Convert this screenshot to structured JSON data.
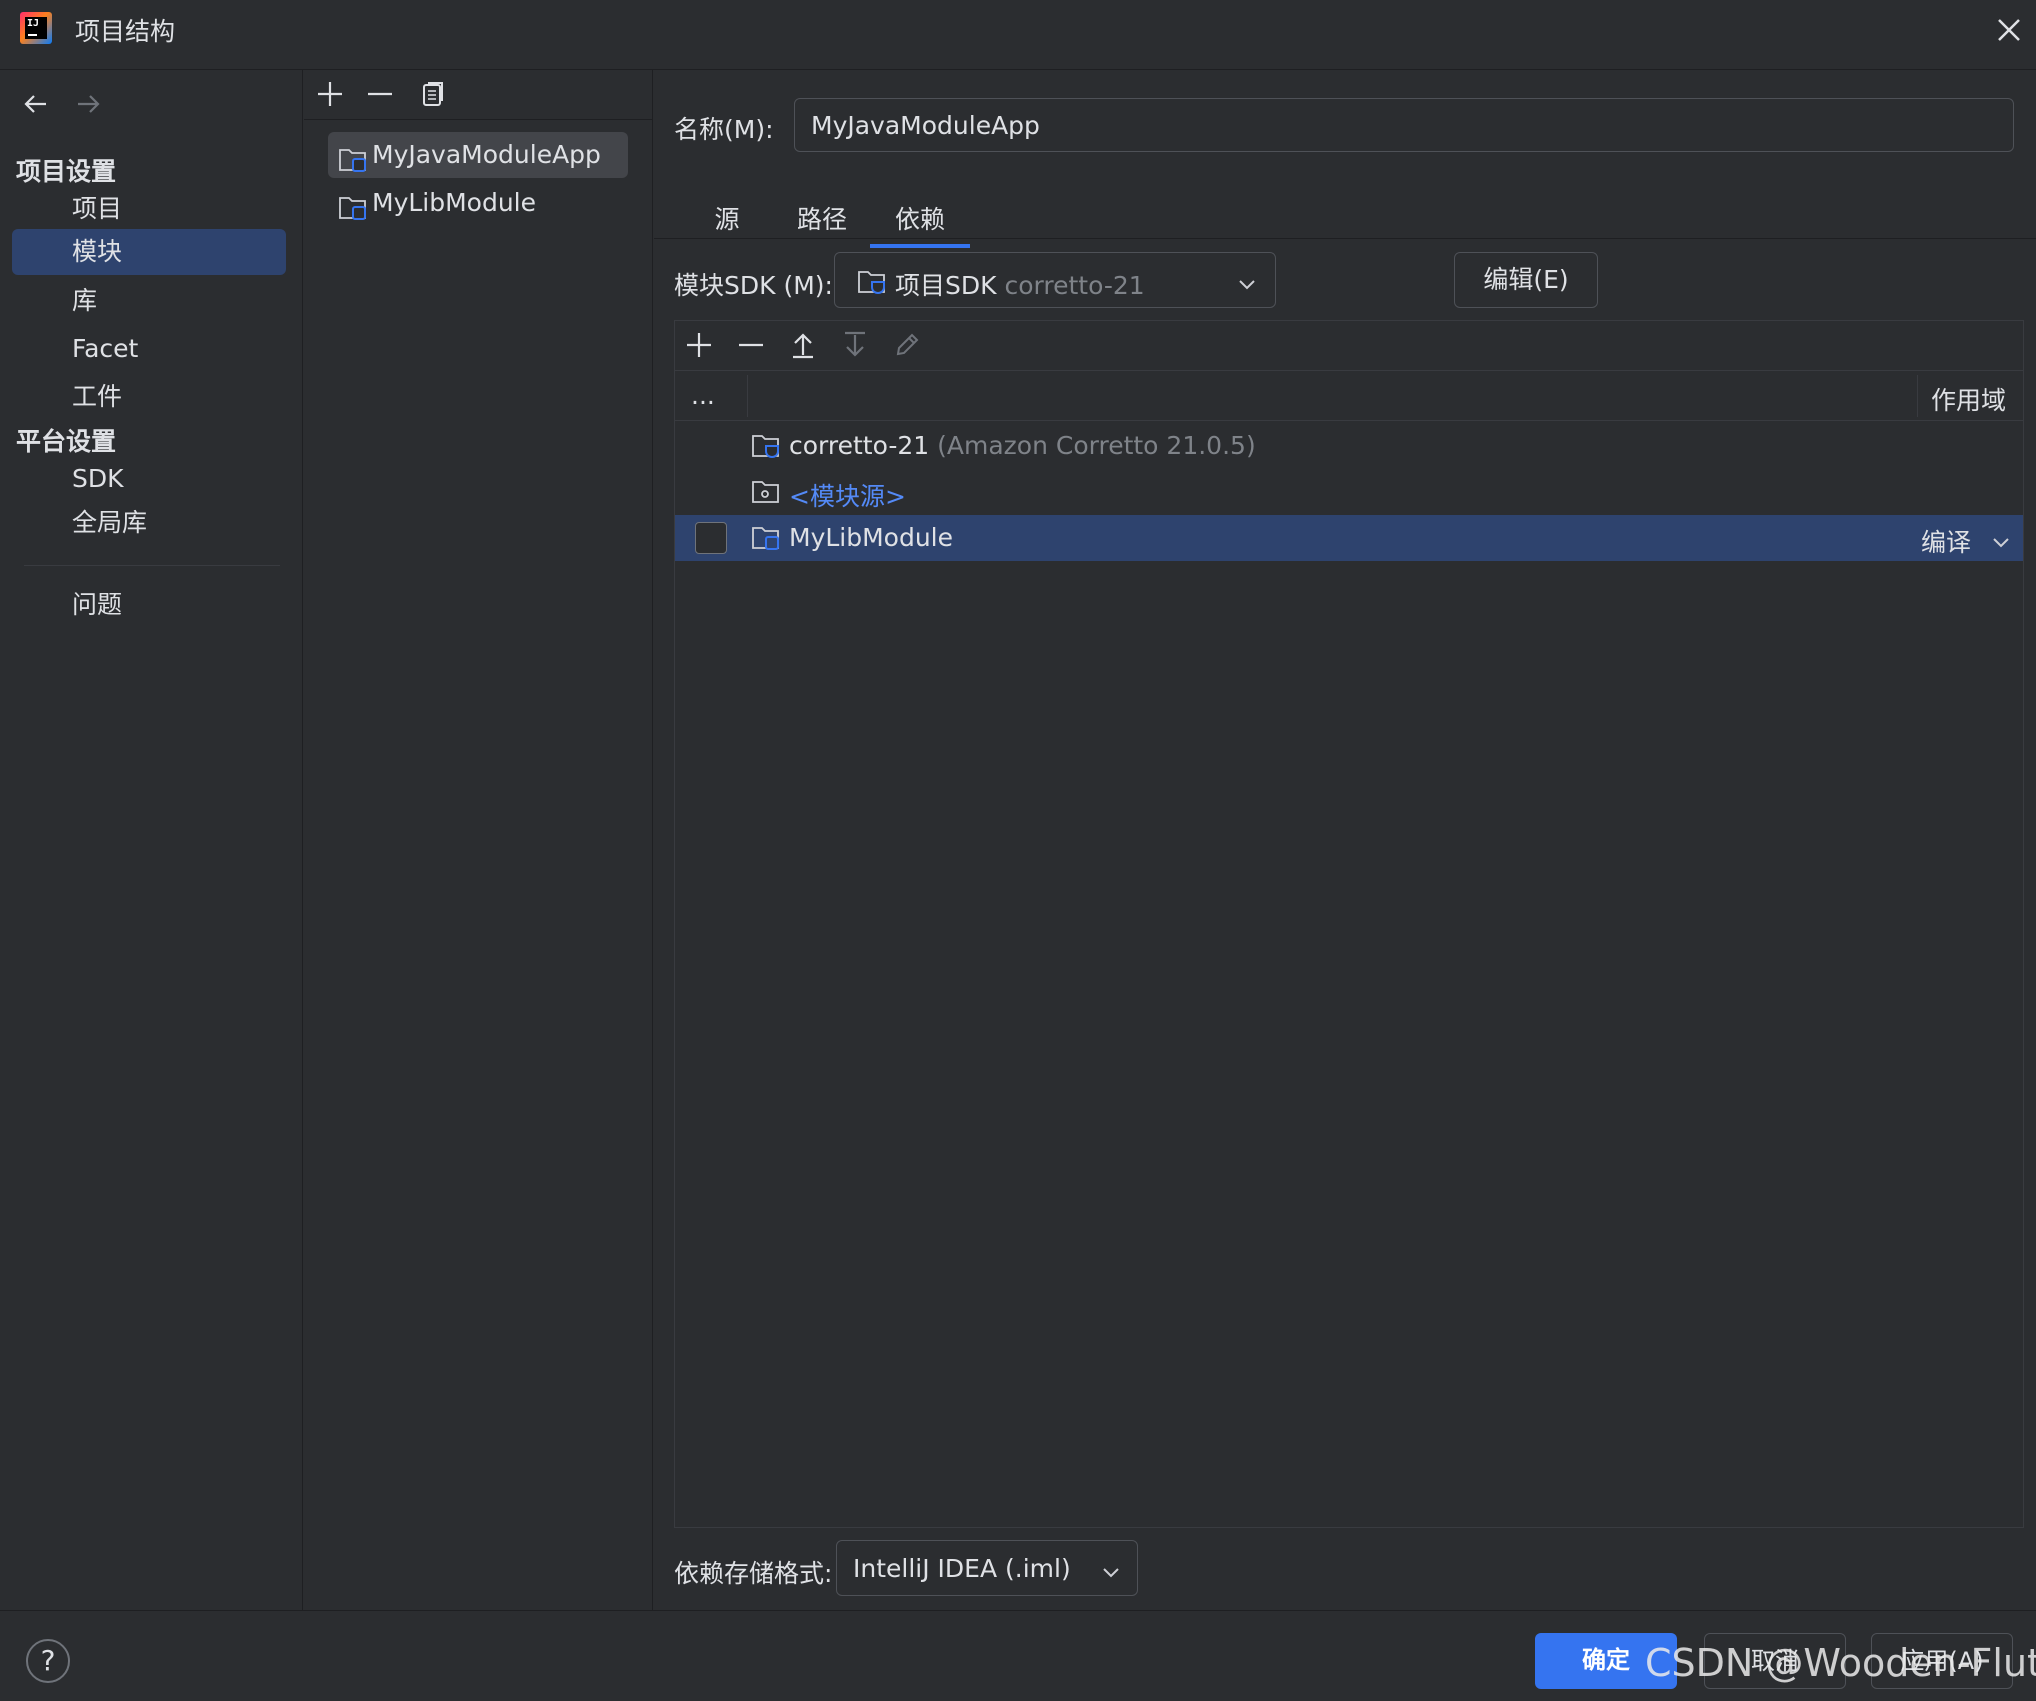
{
  "window": {
    "title": "项目结构",
    "logo_text": "IJ",
    "close_icon": "close-icon"
  },
  "nav": {
    "back_icon": "arrow-left-icon",
    "forward_icon": "arrow-right-icon",
    "project_settings": "项目设置",
    "project_items": [
      {
        "label": "项目"
      },
      {
        "label": "模块",
        "selected": true
      },
      {
        "label": "库"
      },
      {
        "label": "Facet"
      },
      {
        "label": "工件"
      }
    ],
    "platform_settings": "平台设置",
    "platform_items": [
      {
        "label": "SDK"
      },
      {
        "label": "全局库"
      }
    ],
    "problems": "问题"
  },
  "modules": {
    "toolbar": [
      "plus-icon",
      "minus-icon",
      "copy-icon"
    ],
    "items": [
      {
        "label": "MyJavaModuleApp",
        "selected": true
      },
      {
        "label": "MyLibModule"
      }
    ]
  },
  "content": {
    "name_label": "名称(M):",
    "name_value": "MyJavaModuleApp",
    "tabs": [
      {
        "label": "源"
      },
      {
        "label": "路径"
      },
      {
        "label": "依赖",
        "active": true
      }
    ],
    "sdk_label": "模块SDK (M):",
    "sdk_value": "项目SDK",
    "sdk_value_dim": "corretto-21",
    "edit_button": "编辑(E)",
    "deps": {
      "toolbar": [
        "plus-icon",
        "minus-icon",
        "move-up-icon",
        "move-down-icon",
        "edit-icon"
      ],
      "header_export": "...",
      "header_scope": "作用域",
      "rows": [
        {
          "name": "corretto-21",
          "detail": "(Amazon Corretto 21.0.5)"
        },
        {
          "name": "<模块源>"
        },
        {
          "name": "MyLibModule",
          "scope": "编译",
          "checked": false,
          "selected": true
        }
      ]
    },
    "format_label": "依赖存储格式:",
    "format_value": "IntelliJ IDEA (.iml)"
  },
  "footer": {
    "help": "?",
    "ok": "确定",
    "cancel": "取消",
    "apply": "应用(A)",
    "watermark": "CSDN @Wooden-Flute"
  },
  "colors": {
    "background": "#2b2d30",
    "selection": "#2e436e",
    "accent": "#3574f0",
    "link": "#548af7"
  }
}
